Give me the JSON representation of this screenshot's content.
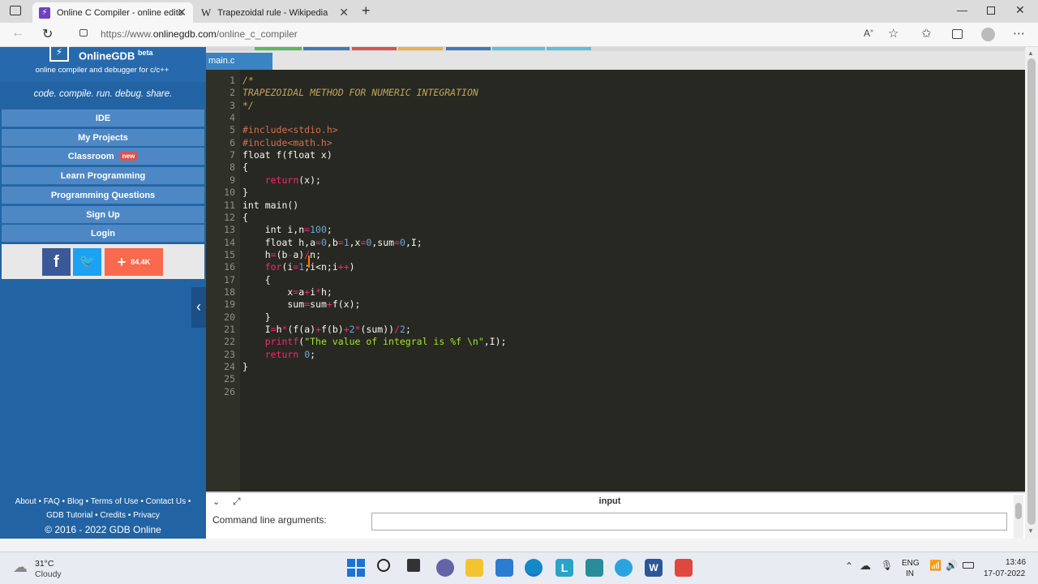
{
  "browser": {
    "tabs": [
      {
        "title": "Online C Compiler - online edito",
        "active": true
      },
      {
        "title": "Trapezoidal rule - Wikipedia",
        "active": false
      }
    ],
    "url_prefix": "https://www.",
    "url_host": "onlinegdb.com",
    "url_path": "/online_c_compiler"
  },
  "sidebar": {
    "brand": "OnlineGDB",
    "brand_sup": "beta",
    "tagline": "online compiler and debugger for c/c++",
    "slogan": "code. compile. run. debug. share.",
    "items": [
      "IDE",
      "My Projects",
      "Classroom",
      "Learn Programming",
      "Programming Questions",
      "Sign Up",
      "Login"
    ],
    "classroom_badge": "new",
    "share_count": "84.4K",
    "footer_line1": "About • FAQ • Blog • Terms of Use • Contact Us •",
    "footer_line2": "GDB Tutorial • Credits • Privacy",
    "footer_line3": "© 2016 - 2022 GDB Online"
  },
  "editor": {
    "file_tab": "main.c",
    "line_numbers": [
      "1",
      "2",
      "3",
      "4",
      "5",
      "6",
      "7",
      "8",
      "9",
      "10",
      "11",
      "12",
      "13",
      "14",
      "15",
      "16",
      "17",
      "18",
      "19",
      "20",
      "21",
      "22",
      "23",
      "24",
      "25",
      "26"
    ],
    "lines": [
      "/*",
      "TRAPEZOIDAL METHOD FOR NUMERIC INTEGRATION",
      "*/",
      "",
      "#include<stdio.h>",
      "#include<math.h>",
      "float f(float x)",
      "{",
      "    return(x);",
      "}",
      "int main()",
      "{",
      "    int i,n=100;",
      "    float h,a=0,b=1,x=0,sum=0,I;",
      "    h=(b-a)/n;",
      "    for(i=1;i<n;i++)",
      "    {",
      "        x=a+i*h;",
      "        sum=sum+f(x);",
      "    }",
      "    I=h*(f(a)+f(b)+2*(sum))/2;",
      "    printf(\"The value of integral is %f \\n\",I);",
      "    return 0;",
      "}",
      "",
      ""
    ]
  },
  "bottom_panel": {
    "title": "input",
    "cmd_label": "Command line arguments:"
  },
  "taskbar": {
    "weather_temp": "31°C",
    "weather_desc": "Cloudy",
    "lang1": "ENG",
    "lang2": "IN",
    "time": "13:46",
    "date": "17-07-2022"
  }
}
